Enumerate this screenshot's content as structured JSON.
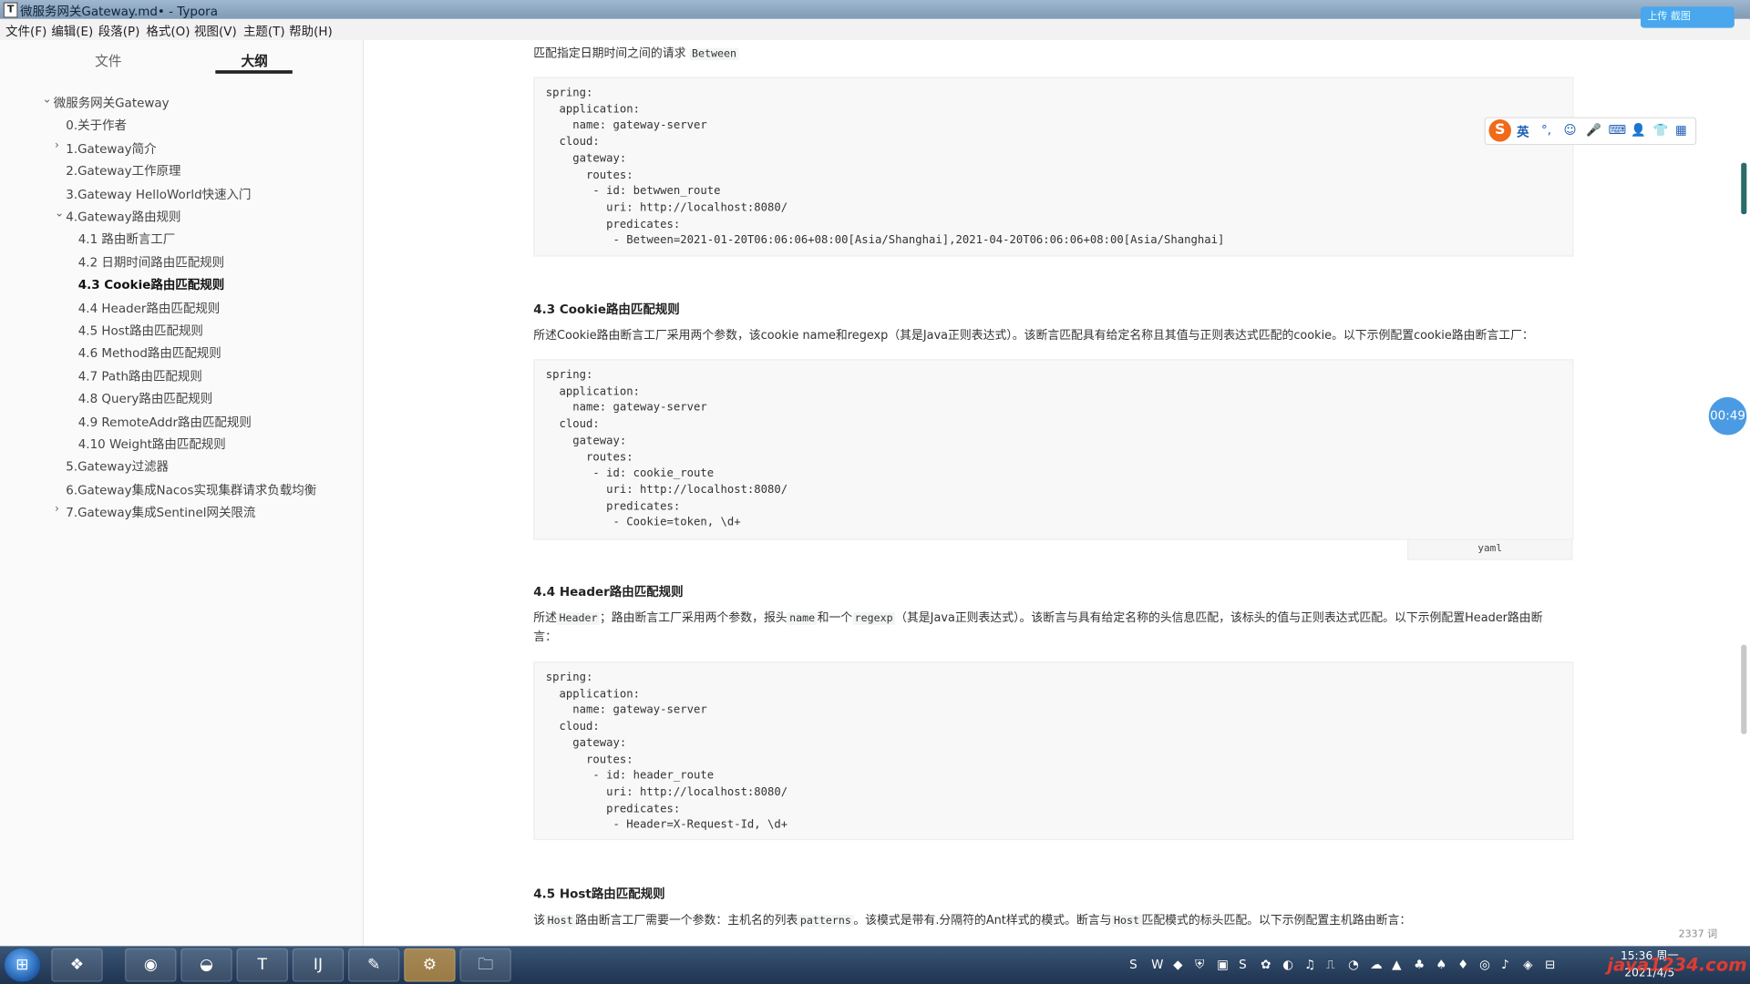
{
  "window": {
    "title": "微服务网关Gateway.md• - Typora",
    "app_icon": "T"
  },
  "menu": [
    "文件(F)",
    "编辑(E)",
    "段落(P)",
    "格式(O)",
    "视图(V)",
    "主题(T)",
    "帮助(H)"
  ],
  "sidebar": {
    "tabs": [
      "文件",
      "大纲"
    ],
    "active_tab": "大纲",
    "outline": [
      {
        "label": "微服务网关Gateway",
        "toggle": "⌄"
      },
      {
        "label": "0.关于作者",
        "toggle": ""
      },
      {
        "label": "1.Gateway简介",
        "toggle": "›"
      },
      {
        "label": "2.Gateway工作原理",
        "toggle": ""
      },
      {
        "label": "3.Gateway HelloWorld快速入门",
        "toggle": ""
      },
      {
        "label": "4.Gateway路由规则",
        "toggle": "⌄"
      },
      {
        "label": "4.1 路由断言工厂",
        "toggle": ""
      },
      {
        "label": "4.2 日期时间路由匹配规则",
        "toggle": ""
      },
      {
        "label": "4.3 Cookie路由匹配规则",
        "toggle": ""
      },
      {
        "label": "4.4 Header路由匹配规则",
        "toggle": ""
      },
      {
        "label": "4.5 Host路由匹配规则",
        "toggle": ""
      },
      {
        "label": "4.6 Method路由匹配规则",
        "toggle": ""
      },
      {
        "label": "4.7 Path路由匹配规则",
        "toggle": ""
      },
      {
        "label": "4.8 Query路由匹配规则",
        "toggle": ""
      },
      {
        "label": "4.9 RemoteAddr路由匹配规则",
        "toggle": ""
      },
      {
        "label": "4.10 Weight路由匹配规则",
        "toggle": ""
      },
      {
        "label": "5.Gateway过滤器",
        "toggle": ""
      },
      {
        "label": "6.Gateway集成Nacos实现集群请求负载均衡",
        "toggle": ""
      },
      {
        "label": "7.Gateway集成Sentinel网关限流",
        "toggle": "›"
      }
    ],
    "footer": {
      "back": "‹",
      "source": "</>"
    }
  },
  "content": {
    "intro_text": "匹配指定日期时间之间的请求",
    "intro_code": "Between",
    "code1": [
      "spring:",
      "  application:",
      "    name: gateway-server",
      "  cloud:",
      "    gateway:",
      "      routes:",
      "       - id: betwwen_route",
      "         uri: http://localhost:8080/",
      "         predicates:",
      "          - Between=2021-01-20T06:06:06+08:00[Asia/Shanghai],2021-04-20T06:06:06+08:00[Asia/Shanghai]"
    ],
    "h_cookie": "4.3 Cookie路由匹配规则",
    "p_cookie": "所述Cookie路由断言工厂采用两个参数，该cookie name和regexp（其是Java正则表达式）。该断言匹配具有给定名称且其值与正则表达式匹配的cookie。以下示例配置cookie路由断言工厂：",
    "code2": [
      "spring:",
      "  application:",
      "    name: gateway-server",
      "  cloud:",
      "    gateway:",
      "      routes:",
      "       - id: cookie_route",
      "         uri: http://localhost:8080/",
      "         predicates:",
      "          - Cookie=token, \\d+"
    ],
    "code2_lang": "yaml",
    "h_header": "4.4 Header路由匹配规则",
    "p_header_1": "所述",
    "p_header_c1": "Header",
    "p_header_2": "；路由断言工厂采用两个参数，报头",
    "p_header_c2": "name",
    "p_header_3": "和一个",
    "p_header_c3": "regexp",
    "p_header_4": "（其是Java正则表达式）。该断言与具有给定名称的头信息匹配，该标头的值与正则表达式匹配。以下示例配置Header路由断",
    "p_header_5": "言：",
    "code3": [
      "spring:",
      "  application:",
      "    name: gateway-server",
      "  cloud:",
      "    gateway:",
      "      routes:",
      "       - id: header_route",
      "         uri: http://localhost:8080/",
      "         predicates:",
      "          - Header=X-Request-Id, \\d+"
    ],
    "h_host": "4.5 Host路由匹配规则",
    "p_host_1": "该",
    "p_host_c1": "Host",
    "p_host_2": "路由断言工厂需要一个参数：主机名的列表",
    "p_host_c2": "patterns",
    "p_host_3": "。该模式是带有.分隔符的Ant样式的模式。断言与",
    "p_host_c3": "Host",
    "p_host_4": "匹配模式的标头匹配。以下示例配置主机路由断言：",
    "word_count": "2337 词"
  },
  "overlays": {
    "ime_logo": "S",
    "ime_lang": "英",
    "ime_icons": [
      "°,",
      "☺",
      "🎤",
      "⌨",
      "👤",
      "👕",
      "▦"
    ],
    "timer": "00:49",
    "cloud_label": "上传 截图"
  },
  "taskbar": {
    "start": "⊞",
    "apps": [
      "❖",
      "◉",
      "◒",
      "T",
      "IJ",
      "✎",
      "⚙",
      "🗀"
    ],
    "active_index": 6,
    "tray": [
      "S",
      "W",
      "◆",
      "⛨",
      "▣",
      "S",
      "✿",
      "◐",
      "♫",
      "⎍",
      "◔",
      "☁",
      "▲",
      "♣",
      "♠",
      "♦",
      "◎",
      "♪",
      "◈",
      "⊟"
    ],
    "time": "15:36 周一",
    "date": "2021/4/5",
    "watermark": "java1234.com"
  }
}
